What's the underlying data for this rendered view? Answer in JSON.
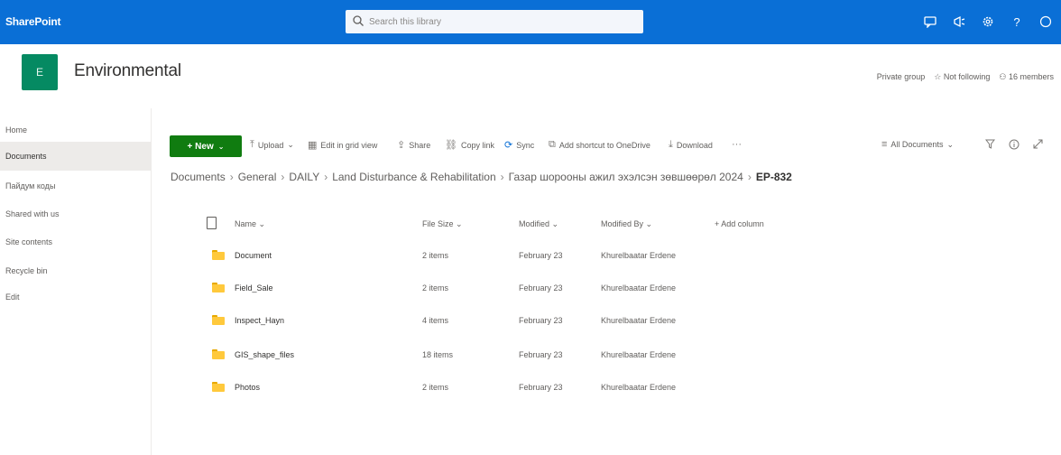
{
  "suite": {
    "app_name": "SharePoint",
    "search_placeholder": "Search this library"
  },
  "site": {
    "logo_letter": "E",
    "title": "Environmental",
    "actions": [
      "Private group",
      "Not following",
      "16 members"
    ]
  },
  "nav": {
    "items": [
      "Home",
      "Documents",
      "Пайдум коды",
      "Shared with us",
      "Site contents",
      "Recycle bin",
      "Edit"
    ],
    "active_index": 1
  },
  "commandbar": {
    "new_label": "+ New",
    "items": [
      {
        "icon": "upload-icon",
        "glyph": "⤒",
        "label": "Upload"
      },
      {
        "icon": "grid-view-icon",
        "glyph": "▦",
        "label": "Edit in grid view"
      },
      {
        "icon": "share-icon",
        "glyph": "⇪",
        "label": "Share"
      },
      {
        "icon": "copy-link-icon",
        "glyph": "⛓",
        "label": "Copy link"
      },
      {
        "icon": "sync-icon",
        "glyph": "⟳",
        "label": "Sync"
      },
      {
        "icon": "onedrive-shortcut-icon",
        "glyph": "⧉",
        "label": "Add shortcut to OneDrive"
      },
      {
        "icon": "download-icon",
        "glyph": "⤓",
        "label": "Download"
      },
      {
        "icon": "more-icon",
        "glyph": "···",
        "label": ""
      }
    ],
    "view_label": "All Documents",
    "filter_icon": "filter-icon",
    "info_icon": "info-icon",
    "expand_icon": "expand-icon"
  },
  "breadcrumb": {
    "items": [
      "Documents",
      "General",
      "DAILY",
      "Land Disturbance & Rehabilitation",
      "Газар шорооны ажил эхэлсэн зөвшөөрөл 2024"
    ],
    "current": "EP-832"
  },
  "table": {
    "headers": {
      "name": "Name",
      "file_size": "File Size",
      "modified": "Modified",
      "modified_by": "Modified By",
      "add_column": "+ Add column"
    },
    "rows": [
      {
        "name": "Document",
        "file_size": "2 items",
        "modified": "February 23",
        "modified_by": "Khurelbaatar Erdene"
      },
      {
        "name": "Field_Sale",
        "file_size": "2 items",
        "modified": "February 23",
        "modified_by": "Khurelbaatar Erdene"
      },
      {
        "name": "Inspect_Hayn",
        "file_size": "4 items",
        "modified": "February 23",
        "modified_by": "Khurelbaatar Erdene"
      },
      {
        "name": "GIS_shape_files",
        "file_size": "18 items",
        "modified": "February 23",
        "modified_by": "Khurelbaatar Erdene"
      },
      {
        "name": "Photos",
        "file_size": "2 items",
        "modified": "February 23",
        "modified_by": "Khurelbaatar Erdene"
      }
    ]
  },
  "colors": {
    "suite_bar": "#0a6fd6",
    "new_button": "#107c10",
    "site_logo": "#058a62",
    "folder": "#ffc93c"
  }
}
